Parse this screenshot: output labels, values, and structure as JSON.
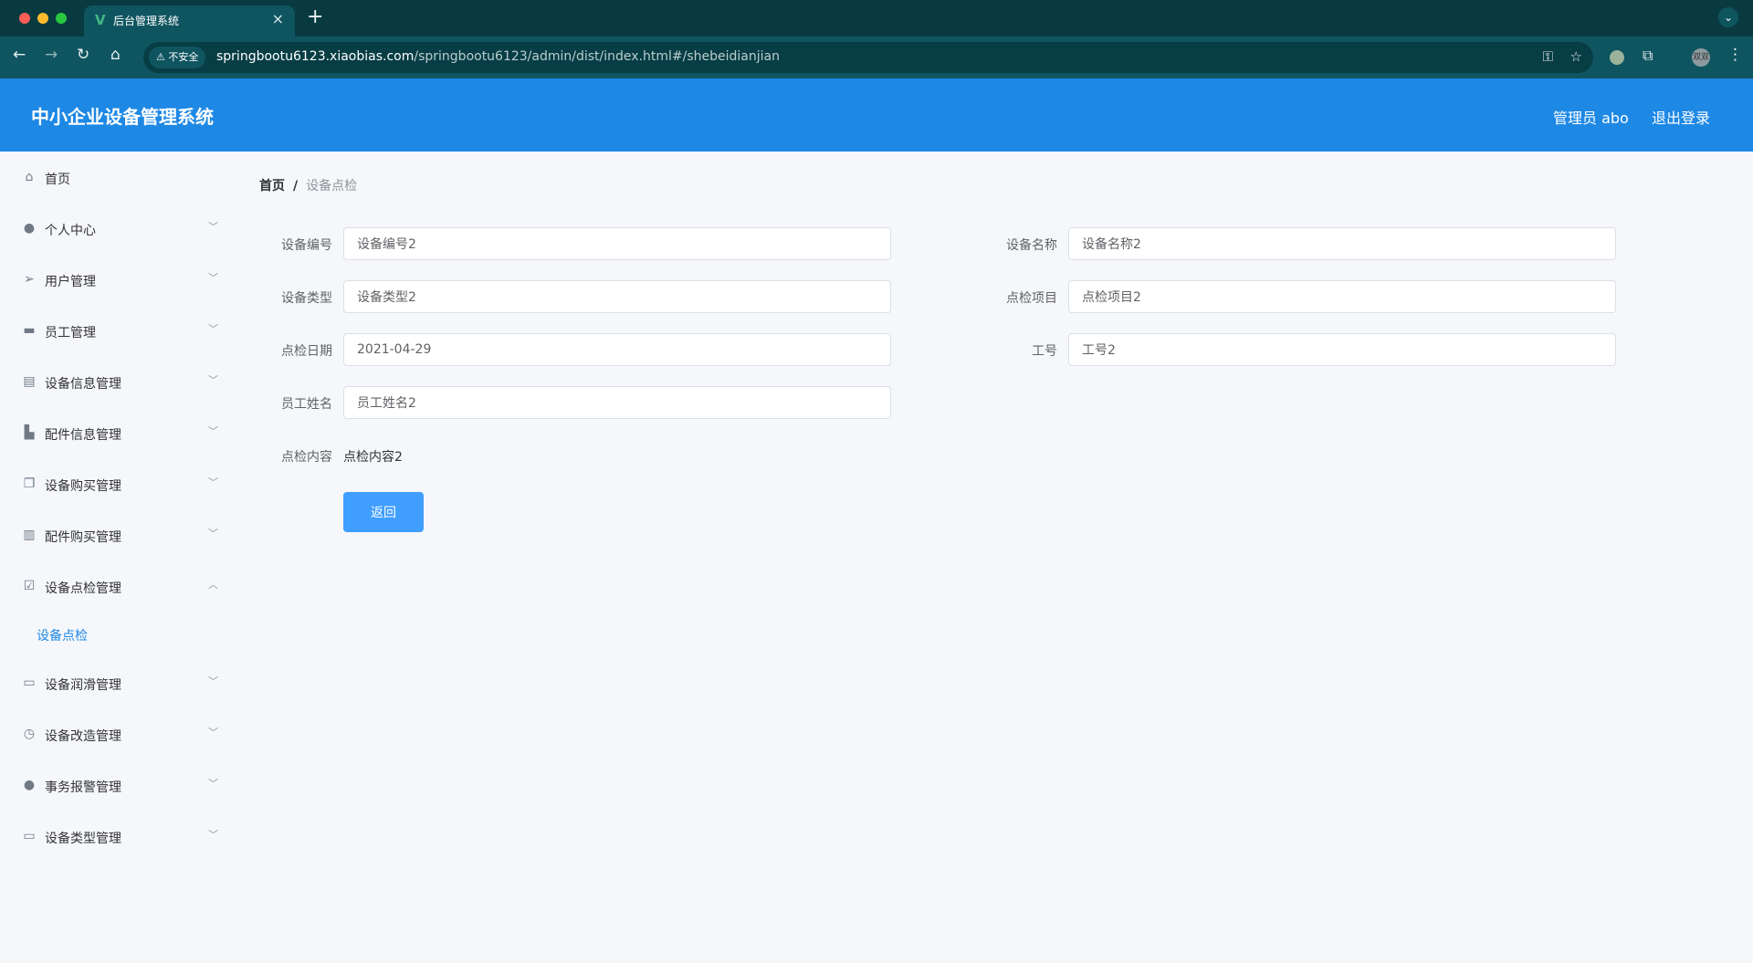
{
  "browser": {
    "tab_title": "后台管理系统",
    "insecure_label": "不安全",
    "url_host": "springbootu6123.xiaobias.com",
    "url_path": "/springbootu6123/admin/dist/index.html#/shebeidianjian",
    "profile_initials": "双双"
  },
  "header": {
    "title": "中小企业设备管理系统",
    "user_label": "管理员 abo",
    "logout_label": "退出登录"
  },
  "sidebar": {
    "items": [
      {
        "label": "首页",
        "icon": "home-icon"
      },
      {
        "label": "个人中心",
        "icon": "user-icon"
      },
      {
        "label": "用户管理",
        "icon": "send-icon"
      },
      {
        "label": "员工管理",
        "icon": "monitor-icon"
      },
      {
        "label": "设备信息管理",
        "icon": "clipboard-icon"
      },
      {
        "label": "配件信息管理",
        "icon": "stamp-icon"
      },
      {
        "label": "设备购买管理",
        "icon": "copy-icon"
      },
      {
        "label": "配件购买管理",
        "icon": "bar-chart-icon"
      },
      {
        "label": "设备点检管理",
        "icon": "checklist-icon",
        "expanded": true
      },
      {
        "label": "设备润滑管理",
        "icon": "message-icon"
      },
      {
        "label": "设备改造管理",
        "icon": "compass-icon"
      },
      {
        "label": "事务报警管理",
        "icon": "person-icon"
      },
      {
        "label": "设备类型管理",
        "icon": "id-card-icon"
      }
    ],
    "sub_active": "设备点检"
  },
  "breadcrumb": {
    "home": "首页",
    "separator": "/",
    "current": "设备点检"
  },
  "form": {
    "fields": [
      {
        "label": "设备编号",
        "value": "设备编号2"
      },
      {
        "label": "设备名称",
        "value": "设备名称2"
      },
      {
        "label": "设备类型",
        "value": "设备类型2"
      },
      {
        "label": "点检项目",
        "value": "点检项目2"
      },
      {
        "label": "点检日期",
        "value": "2021-04-29"
      },
      {
        "label": "工号",
        "value": "工号2"
      },
      {
        "label": "员工姓名",
        "value": "员工姓名2"
      }
    ],
    "content_label": "点检内容",
    "content_value": "点检内容2",
    "back_label": "返回"
  },
  "colors": {
    "primary": "#1e88e5",
    "button": "#409eff",
    "browser_frame": "#083a40"
  }
}
